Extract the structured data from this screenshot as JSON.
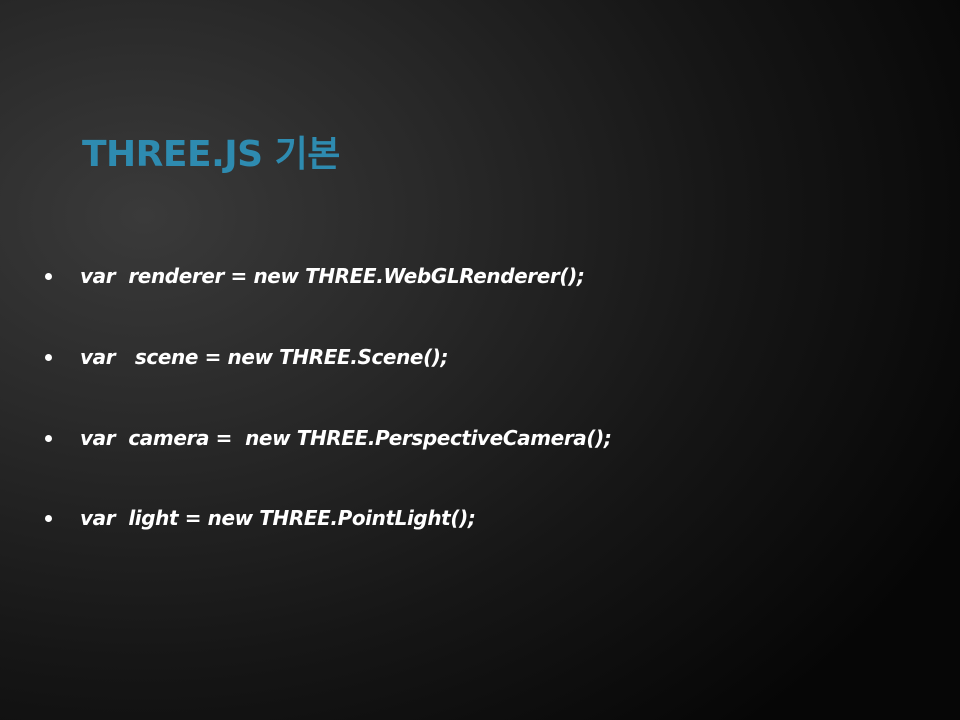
{
  "slide": {
    "title": "THREE.JS 기본",
    "title_color": "#2e8bb0",
    "bullets": [
      {
        "text": "var  renderer = new THREE.WebGLRenderer();"
      },
      {
        "text": "var   scene = new THREE.Scene();"
      },
      {
        "text": "var  camera =  new THREE.PerspectiveCamera();"
      },
      {
        "text": "var  light = new THREE.PointLight();"
      }
    ]
  }
}
